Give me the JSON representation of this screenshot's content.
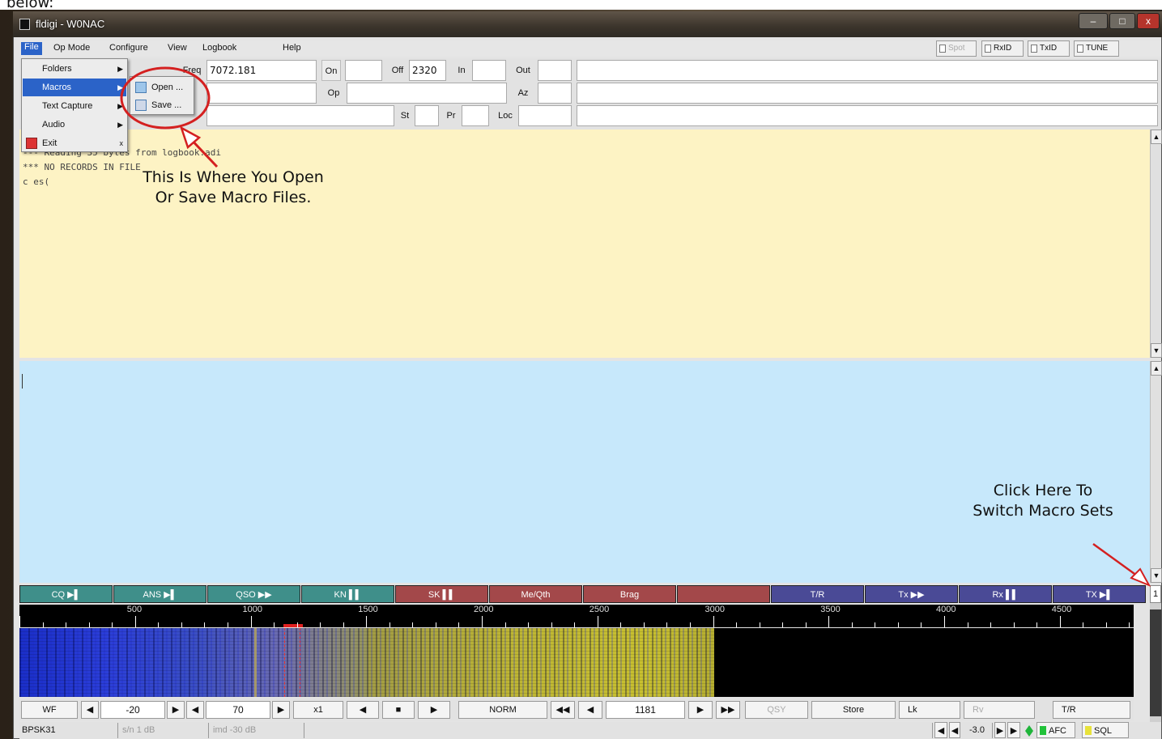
{
  "page_caption": "below:",
  "window": {
    "title": "fldigi - W0NAC",
    "min": "–",
    "max": "□",
    "close": "x"
  },
  "menubar": {
    "items": [
      "File",
      "Op Mode",
      "Configure",
      "View",
      "Logbook",
      "Help"
    ],
    "right_buttons": [
      "Spot",
      "RxID",
      "TxID",
      "TUNE"
    ]
  },
  "file_menu": {
    "items": [
      {
        "label": "Folders"
      },
      {
        "label": "Macros"
      },
      {
        "label": "Text Capture"
      },
      {
        "label": "Audio"
      },
      {
        "label": "Exit",
        "shortcut": "x"
      }
    ],
    "submenu": [
      "Open ...",
      "Save ..."
    ]
  },
  "log_panel": {
    "freq_label": "Freq",
    "freq_value": "7072.181",
    "on_label": "On",
    "off_label": "Off",
    "off_value": "2320",
    "in_label": "In",
    "out_label": "Out",
    "op_label": "Op",
    "az_label": "Az",
    "st_label": "St",
    "pr_label": "Pr",
    "loc_label": "Loc"
  },
  "rx_text": [
    "--- Reading 35 bytes from logbook.adi",
    "*** NO RECORDS IN FILE",
    "c  es("
  ],
  "annotations": {
    "macro_files": [
      "This Is Where You Open",
      "Or Save Macro Files."
    ],
    "macro_sets": [
      "Click Here To",
      "Switch Macro Sets"
    ]
  },
  "macro_bar": {
    "buttons": [
      {
        "label": "CQ ▶▌",
        "color": "#3f8f8a"
      },
      {
        "label": "ANS ▶▌",
        "color": "#3f8f8a"
      },
      {
        "label": "QSO ▶▶",
        "color": "#3f8f8a"
      },
      {
        "label": "KN ▌▌",
        "color": "#3f8f8a"
      },
      {
        "label": "SK ▌▌",
        "color": "#a3484a"
      },
      {
        "label": "Me/Qth",
        "color": "#a3484a"
      },
      {
        "label": "Brag",
        "color": "#a3484a"
      },
      {
        "label": "",
        "color": "#a3484a"
      },
      {
        "label": "T/R",
        "color": "#4a4a96"
      },
      {
        "label": "Tx ▶▶",
        "color": "#4a4a96"
      },
      {
        "label": "Rx ▌▌",
        "color": "#4a4a96"
      },
      {
        "label": "TX ▶▌",
        "color": "#4a4a96"
      }
    ],
    "set_number": "1"
  },
  "ruler": {
    "labels": [
      "500",
      "1000",
      "1500",
      "2000",
      "2500",
      "3000",
      "3500",
      "4000",
      "4500"
    ]
  },
  "controls": {
    "wf": "WF",
    "min_db": "-20",
    "range_db": "70",
    "zoom": "x1",
    "mode": "NORM",
    "freq": "1181",
    "qsy": "QSY",
    "store": "Store",
    "lk": "Lk",
    "rv": "Rv",
    "tr": "T/R"
  },
  "status": {
    "mode": "BPSK31",
    "sn": "s/n  1 dB",
    "imd": "imd -30 dB",
    "afc_value": "-3.0",
    "afc": "AFC",
    "sql": "SQL"
  }
}
